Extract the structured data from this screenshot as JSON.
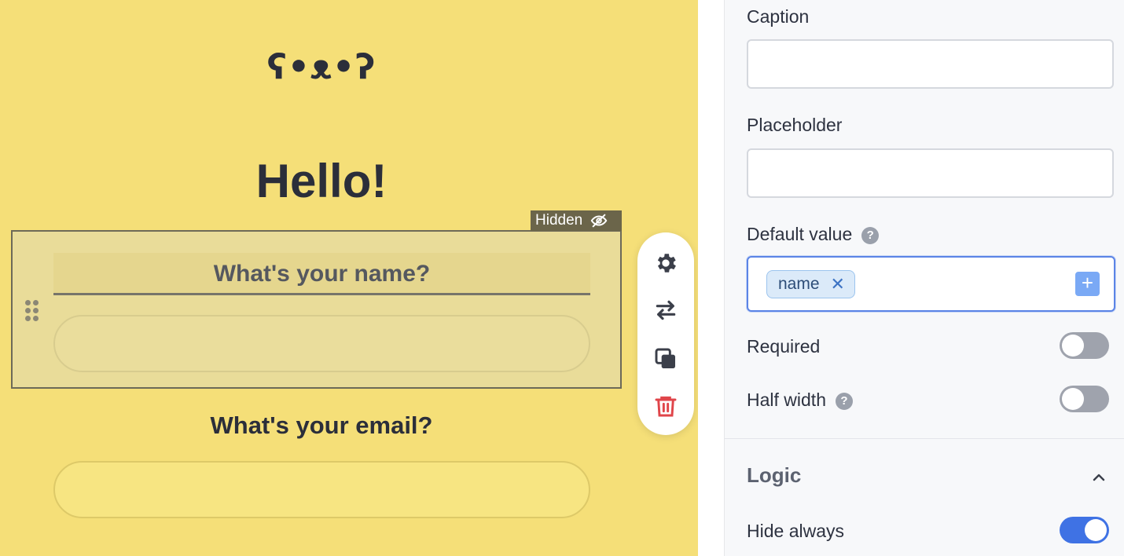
{
  "canvas": {
    "logo_text": "ʕ•ᴥ•ʔ",
    "heading": "Hello!",
    "hidden_badge": "Hidden",
    "name_question": "What's your name?",
    "email_question": "What's your email?",
    "toolbar_icons": [
      "gear-icon",
      "swap-icon",
      "duplicate-icon",
      "trash-icon"
    ]
  },
  "panel": {
    "caption_label": "Caption",
    "caption_value": "",
    "placeholder_label": "Placeholder",
    "placeholder_value": "",
    "default_value_label": "Default value",
    "default_value_tag": "name",
    "required_label": "Required",
    "required_on": false,
    "half_width_label": "Half width",
    "half_width_on": false,
    "logic_title": "Logic",
    "hide_always_label": "Hide always",
    "hide_always_on": true
  },
  "colors": {
    "canvas_bg": "#f5df78",
    "accent": "#3f72e4",
    "delete": "#e0454a"
  }
}
